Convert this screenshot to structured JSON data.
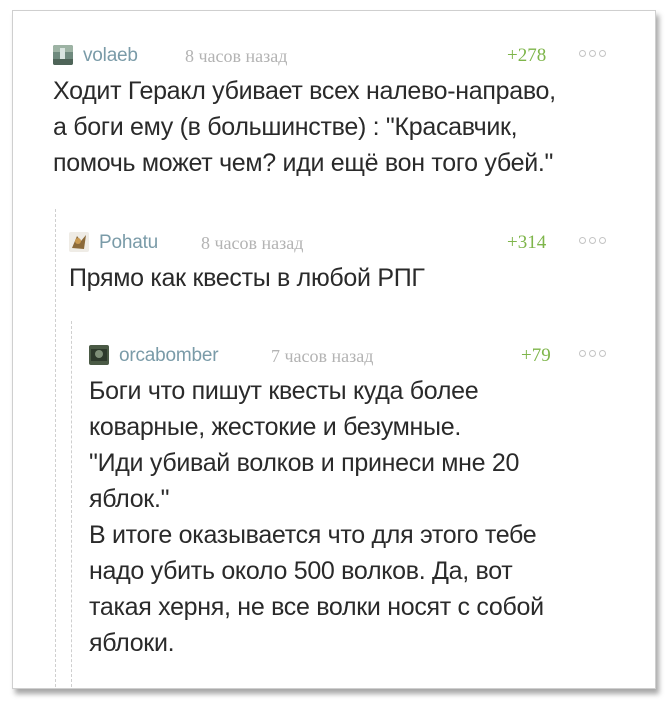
{
  "comments": [
    {
      "username": "volaeb",
      "time": "8 часов назад",
      "rating": "+278",
      "avatar_icon": "waterfall-avatar-icon",
      "text": "Ходит Геракл убивает всех налево-направо,\nа боги ему (в большинстве) : \"Красавчик,\nпомочь может чем? иди ещё вон того убей.\""
    },
    {
      "username": "Pohatu",
      "time": "8 часов назад",
      "rating": "+314",
      "avatar_icon": "bionicle-avatar-icon",
      "text": "Прямо как квесты в любой РПГ"
    },
    {
      "username": "orcabomber",
      "time": "7 часов назад",
      "rating": "+79",
      "avatar_icon": "orca-avatar-icon",
      "paragraphs": [
        "Боги что пишут квесты куда более\nковарные, жестокие и безумные.",
        "\"Иди убивай волков и принеси мне 20\nяблок.\"",
        "В итоге оказывается что для этого тебе\nнадо убить около 500 волков. Да, вот\nтакая херня, не все волки носят с собой\nяблоки."
      ]
    }
  ],
  "colors": {
    "username": "#7a9ba8",
    "time": "#b3b3b3",
    "rating": "#7eb54a",
    "text": "#2a2a2a",
    "thread_line": "#cfcfcf"
  }
}
